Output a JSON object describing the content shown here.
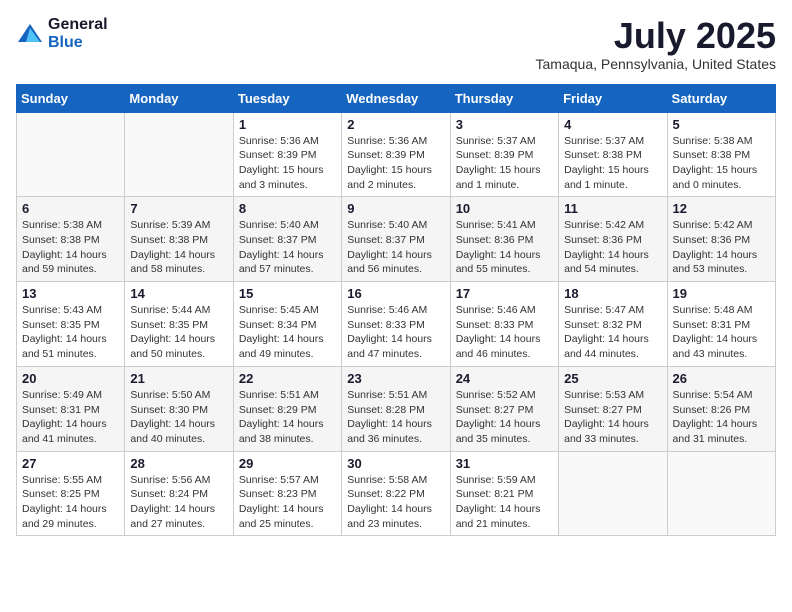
{
  "logo": {
    "general": "General",
    "blue": "Blue"
  },
  "header": {
    "month": "July 2025",
    "location": "Tamaqua, Pennsylvania, United States"
  },
  "weekdays": [
    "Sunday",
    "Monday",
    "Tuesday",
    "Wednesday",
    "Thursday",
    "Friday",
    "Saturday"
  ],
  "weeks": [
    [
      {
        "day": "",
        "info": ""
      },
      {
        "day": "",
        "info": ""
      },
      {
        "day": "1",
        "info": "Sunrise: 5:36 AM\nSunset: 8:39 PM\nDaylight: 15 hours\nand 3 minutes."
      },
      {
        "day": "2",
        "info": "Sunrise: 5:36 AM\nSunset: 8:39 PM\nDaylight: 15 hours\nand 2 minutes."
      },
      {
        "day": "3",
        "info": "Sunrise: 5:37 AM\nSunset: 8:39 PM\nDaylight: 15 hours\nand 1 minute."
      },
      {
        "day": "4",
        "info": "Sunrise: 5:37 AM\nSunset: 8:38 PM\nDaylight: 15 hours\nand 1 minute."
      },
      {
        "day": "5",
        "info": "Sunrise: 5:38 AM\nSunset: 8:38 PM\nDaylight: 15 hours\nand 0 minutes."
      }
    ],
    [
      {
        "day": "6",
        "info": "Sunrise: 5:38 AM\nSunset: 8:38 PM\nDaylight: 14 hours\nand 59 minutes."
      },
      {
        "day": "7",
        "info": "Sunrise: 5:39 AM\nSunset: 8:38 PM\nDaylight: 14 hours\nand 58 minutes."
      },
      {
        "day": "8",
        "info": "Sunrise: 5:40 AM\nSunset: 8:37 PM\nDaylight: 14 hours\nand 57 minutes."
      },
      {
        "day": "9",
        "info": "Sunrise: 5:40 AM\nSunset: 8:37 PM\nDaylight: 14 hours\nand 56 minutes."
      },
      {
        "day": "10",
        "info": "Sunrise: 5:41 AM\nSunset: 8:36 PM\nDaylight: 14 hours\nand 55 minutes."
      },
      {
        "day": "11",
        "info": "Sunrise: 5:42 AM\nSunset: 8:36 PM\nDaylight: 14 hours\nand 54 minutes."
      },
      {
        "day": "12",
        "info": "Sunrise: 5:42 AM\nSunset: 8:36 PM\nDaylight: 14 hours\nand 53 minutes."
      }
    ],
    [
      {
        "day": "13",
        "info": "Sunrise: 5:43 AM\nSunset: 8:35 PM\nDaylight: 14 hours\nand 51 minutes."
      },
      {
        "day": "14",
        "info": "Sunrise: 5:44 AM\nSunset: 8:35 PM\nDaylight: 14 hours\nand 50 minutes."
      },
      {
        "day": "15",
        "info": "Sunrise: 5:45 AM\nSunset: 8:34 PM\nDaylight: 14 hours\nand 49 minutes."
      },
      {
        "day": "16",
        "info": "Sunrise: 5:46 AM\nSunset: 8:33 PM\nDaylight: 14 hours\nand 47 minutes."
      },
      {
        "day": "17",
        "info": "Sunrise: 5:46 AM\nSunset: 8:33 PM\nDaylight: 14 hours\nand 46 minutes."
      },
      {
        "day": "18",
        "info": "Sunrise: 5:47 AM\nSunset: 8:32 PM\nDaylight: 14 hours\nand 44 minutes."
      },
      {
        "day": "19",
        "info": "Sunrise: 5:48 AM\nSunset: 8:31 PM\nDaylight: 14 hours\nand 43 minutes."
      }
    ],
    [
      {
        "day": "20",
        "info": "Sunrise: 5:49 AM\nSunset: 8:31 PM\nDaylight: 14 hours\nand 41 minutes."
      },
      {
        "day": "21",
        "info": "Sunrise: 5:50 AM\nSunset: 8:30 PM\nDaylight: 14 hours\nand 40 minutes."
      },
      {
        "day": "22",
        "info": "Sunrise: 5:51 AM\nSunset: 8:29 PM\nDaylight: 14 hours\nand 38 minutes."
      },
      {
        "day": "23",
        "info": "Sunrise: 5:51 AM\nSunset: 8:28 PM\nDaylight: 14 hours\nand 36 minutes."
      },
      {
        "day": "24",
        "info": "Sunrise: 5:52 AM\nSunset: 8:27 PM\nDaylight: 14 hours\nand 35 minutes."
      },
      {
        "day": "25",
        "info": "Sunrise: 5:53 AM\nSunset: 8:27 PM\nDaylight: 14 hours\nand 33 minutes."
      },
      {
        "day": "26",
        "info": "Sunrise: 5:54 AM\nSunset: 8:26 PM\nDaylight: 14 hours\nand 31 minutes."
      }
    ],
    [
      {
        "day": "27",
        "info": "Sunrise: 5:55 AM\nSunset: 8:25 PM\nDaylight: 14 hours\nand 29 minutes."
      },
      {
        "day": "28",
        "info": "Sunrise: 5:56 AM\nSunset: 8:24 PM\nDaylight: 14 hours\nand 27 minutes."
      },
      {
        "day": "29",
        "info": "Sunrise: 5:57 AM\nSunset: 8:23 PM\nDaylight: 14 hours\nand 25 minutes."
      },
      {
        "day": "30",
        "info": "Sunrise: 5:58 AM\nSunset: 8:22 PM\nDaylight: 14 hours\nand 23 minutes."
      },
      {
        "day": "31",
        "info": "Sunrise: 5:59 AM\nSunset: 8:21 PM\nDaylight: 14 hours\nand 21 minutes."
      },
      {
        "day": "",
        "info": ""
      },
      {
        "day": "",
        "info": ""
      }
    ]
  ]
}
